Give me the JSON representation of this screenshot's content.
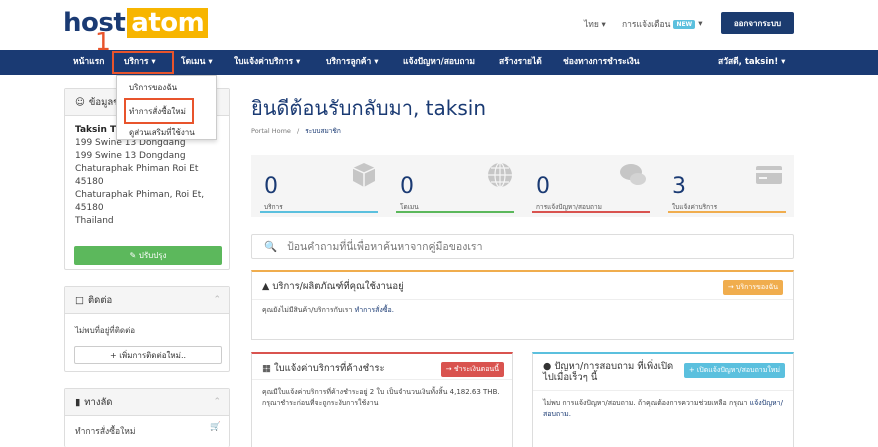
{
  "header": {
    "logo_host": "host",
    "logo_atom": "atom",
    "language": "ไทย ▾",
    "notifications": "การแจ้งเตือน",
    "new_badge": "NEW",
    "notif_caret": "▾",
    "logout": "ออกจากระบบ"
  },
  "nav": {
    "home": "หน้าแรก",
    "services": "บริการ ▾",
    "domains": "โดเมน ▾",
    "billing": "ใบแจ้งค่าบริการ ▾",
    "support": "บริการลูกค้า ▾",
    "tickets": "แจ้งปัญหา/สอบถาม",
    "affiliates": "สร้างรายได้",
    "payment": "ช่องทางการชำระเงิน",
    "user": "สวัสดี, taksin! ▾"
  },
  "markers": {
    "one": "1",
    "two": "2"
  },
  "dropdown": {
    "items": [
      "บริการของฉัน",
      "ทำการสั่งซื้อใหม่",
      "ดูส่วนเสริมที่ใช้งาน"
    ]
  },
  "sidebar": {
    "info_title": "ข้อมูลของคุณ",
    "name": "Taksin Th",
    "address": [
      "199 Swine 13 Dongdang",
      "199 Swine 13 Dongdang",
      "Chaturaphak Phiman Roi Et",
      "45180",
      "Chaturaphak Phiman, Roi Et,",
      "45180",
      "Thailand"
    ],
    "update_btn": "✎ ปรับปรุง",
    "contacts_title": "ติดต่อ",
    "no_contacts": "ไม่พบที่อยู่ที่ติดต่อ",
    "add_contact_btn": "+ เพิ่มการติดต่อใหม่..",
    "shortcuts_title": "ทางลัด",
    "shortcut_order": "ทำการสั่งซื้อใหม่"
  },
  "main": {
    "welcome": "ยินดีต้อนรับกลับมา, taksin",
    "breadcrumb_home": "Portal Home",
    "breadcrumb_sep": "/",
    "breadcrumb_current": "ระบบสมาชิก",
    "search_placeholder": "ป้อนคำถามที่นี่เพื่อหาค้นหาจากคู่มือของเรา"
  },
  "stats": [
    {
      "value": "0",
      "label": "บริการ",
      "color": "#5bc0de",
      "icon": "box-icon"
    },
    {
      "value": "0",
      "label": "โดเมน",
      "color": "#5cb85c",
      "icon": "globe-icon"
    },
    {
      "value": "0",
      "label": "การแจ้งปัญหา/สอบถาม",
      "color": "#d9534f",
      "icon": "comments-icon"
    },
    {
      "value": "3",
      "label": "ใบแจ้งค่าบริการ",
      "color": "#f0ad4e",
      "icon": "credit-card-icon"
    }
  ],
  "cards": {
    "services": {
      "title": "บริการ/ผลิตภัณฑ์ที่คุณใช้งานอยู่",
      "btn": "→ บริการของฉัน",
      "body_text": "คุณยังไม่มีสินค้า/บริการกับเรา",
      "body_link": "ทำการสั่งซื้อ."
    },
    "invoices": {
      "title": "ใบแจ้งค่าบริการที่ค้างชำระ",
      "btn": "→ ชำระเงินตอนนี้",
      "body": "คุณมีใบแจ้งค่าบริการที่ค้างชำระอยู่ 2 ใบ เป็นจำนวนเงินทั้งสิ้น 4,182.63 THB. กรุณาชำระก่อนที่จะถูกระงับการใช้งาน"
    },
    "tickets": {
      "title": "ปัญหา/การสอบถาม ที่เพิ่งเปิดไปเมื่อเร็วๆ นี้",
      "btn": "+ เปิดแจ้งปัญหา/สอบถามใหม่",
      "body_text": "ไม่พบ การแจ้งปัญหา/สอบถาม. ถ้าคุณต้องการความช่วยเหลือ กรุณา",
      "body_link": "แจ้งปัญหา/สอบถาม."
    }
  },
  "colors": {
    "navy": "#1a3a73",
    "orange_highlight": "#e8542c",
    "brand_yellow": "#f7b500",
    "green": "#5cb85c",
    "orange": "#f0ad4e",
    "red": "#d9534f",
    "blue": "#5bc0de"
  }
}
